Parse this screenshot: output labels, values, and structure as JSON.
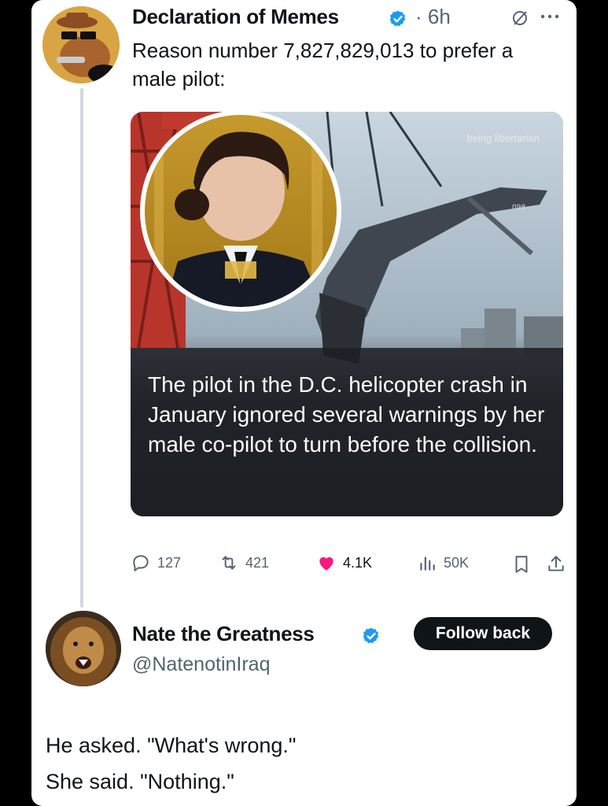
{
  "post": {
    "author_name": "Declaration of Memes",
    "time": "· 6h",
    "text": "Reason number 7,827,829,013 to prefer a male pilot:",
    "media": {
      "watermark": "being libertarian",
      "caption": "The pilot in the D.C. helicopter crash in January ignored several warnings by her male co-pilot to turn before the collision."
    },
    "actions": {
      "replies": "127",
      "reposts": "421",
      "likes": "4.1K",
      "views": "50K"
    }
  },
  "reply": {
    "author_name": "Nate the Greatness",
    "handle": "@NatenotinIraq",
    "follow_label": "Follow back",
    "lines": [
      "He asked. \"What's wrong.\"",
      "She said. \"Nothing.\""
    ]
  },
  "colors": {
    "verified": "#1d9bf0",
    "like": "#f91880",
    "text": "#0f1419",
    "muted": "#536471"
  },
  "icons": [
    "verified-badge-icon",
    "grok-slash-icon",
    "more-icon",
    "reply-icon",
    "repost-icon",
    "heart-icon",
    "views-icon",
    "bookmark-icon",
    "share-icon"
  ]
}
